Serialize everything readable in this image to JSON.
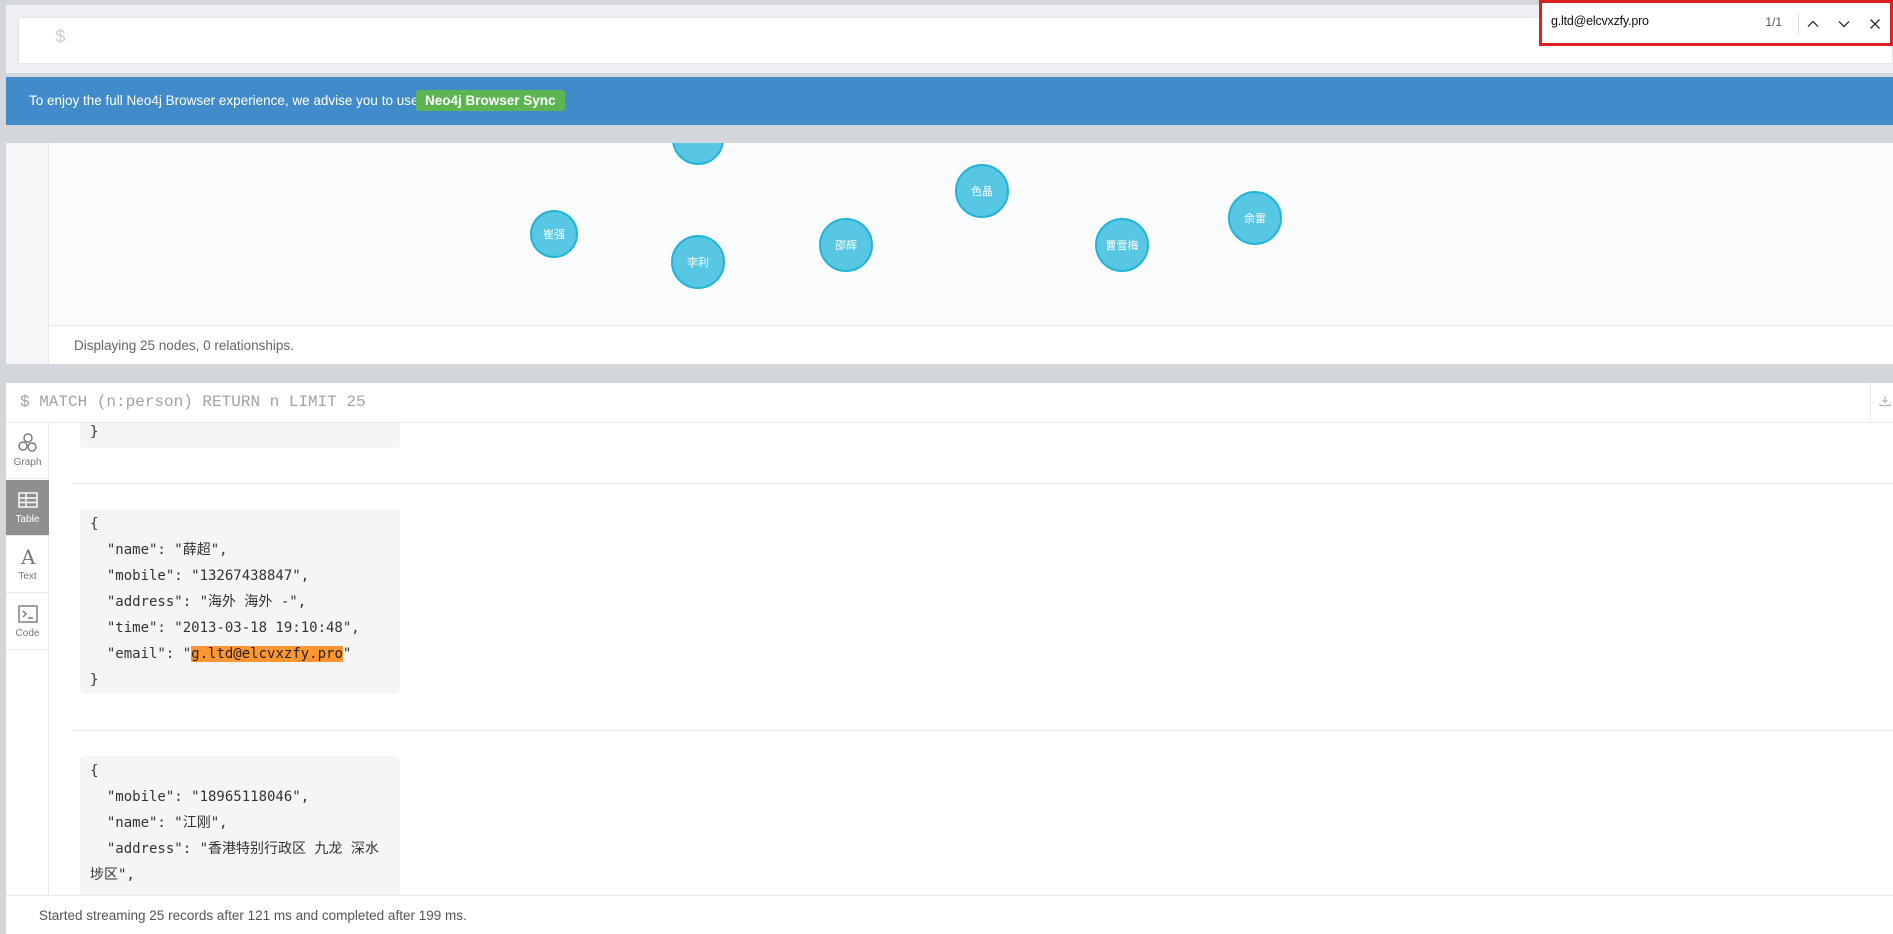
{
  "editor": {
    "prompt": "$"
  },
  "banner": {
    "text": "To enjoy the full Neo4j Browser experience, we advise you to use",
    "button_label": "Neo4j Browser Sync"
  },
  "graph_frame": {
    "nodes": [
      "崔强",
      "李利",
      "邵辉",
      "色晶",
      "曹雪梅",
      "余雷"
    ],
    "status": "Displaying 25 nodes, 0 relationships."
  },
  "table_frame": {
    "query": "$ MATCH (n:person) RETURN n LIMIT 25",
    "tabs": [
      {
        "label": "Graph",
        "icon": "graph-icon"
      },
      {
        "label": "Table",
        "icon": "table-icon"
      },
      {
        "label": "Text",
        "icon": "text-icon"
      },
      {
        "label": "Code",
        "icon": "code-icon"
      }
    ],
    "active_tab": "Table",
    "records": [
      {
        "lines": [
          "}"
        ]
      },
      {
        "lines": [
          "{",
          "  \"name\": \"薛超\",",
          "  \"mobile\": \"13267438847\",",
          "  \"address\": \"海外 海外 -\",",
          "  \"time\": \"2013-03-18 19:10:48\","
        ],
        "email_prefix": "  \"email\": \"",
        "email_value": "g.ltd@elcvxzfy.pro",
        "email_suffix": "\"",
        "close": "}"
      },
      {
        "lines": [
          "{",
          "  \"mobile\": \"18965118046\",",
          "  \"name\": \"江刚\",",
          "  \"address\": \"香港特别行政区 九龙 深水",
          "埗区\","
        ]
      }
    ],
    "status": "Started streaming 25 records after 121 ms and completed after 199 ms."
  },
  "find_bar": {
    "query": "g.ltd@elcvxzfy.pro",
    "count": "1/1"
  },
  "colors": {
    "banner": "#428bca",
    "sync_button": "#5db551",
    "node_fill": "#57c7e3",
    "node_border": "#23b3d7",
    "highlight": "#ff9632",
    "find_border": "#e02020"
  }
}
